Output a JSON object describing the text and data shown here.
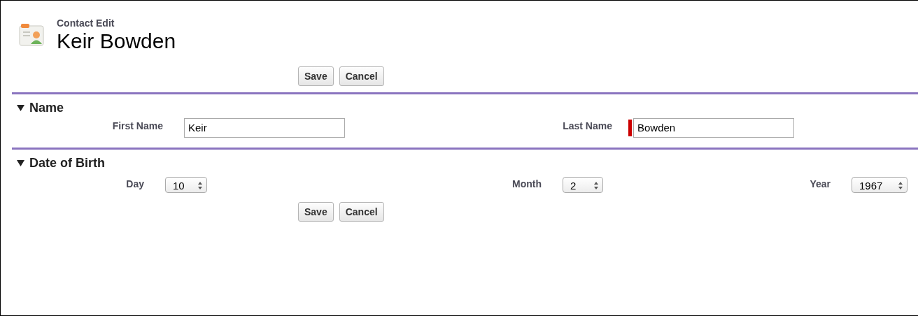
{
  "header": {
    "subtitle": "Contact Edit",
    "title": "Keir Bowden"
  },
  "top_buttons": [
    "Save",
    "Cancel"
  ],
  "sections": [
    {
      "title": "Name",
      "expanded": true,
      "fields": [
        {
          "label": "First Name",
          "kind": "text",
          "value": "Keir",
          "required": false
        },
        {
          "label": "Last Name",
          "kind": "text",
          "value": "Bowden",
          "required": true
        }
      ]
    },
    {
      "title": "Date of Birth",
      "expanded": true,
      "fields": [
        {
          "label": "Day",
          "kind": "select",
          "value": "10"
        },
        {
          "label": "Month",
          "kind": "select",
          "value": "2"
        },
        {
          "label": "Year",
          "kind": "select",
          "value": "1967"
        }
      ]
    }
  ],
  "bottom_buttons": [
    "Save",
    "Cancel"
  ]
}
